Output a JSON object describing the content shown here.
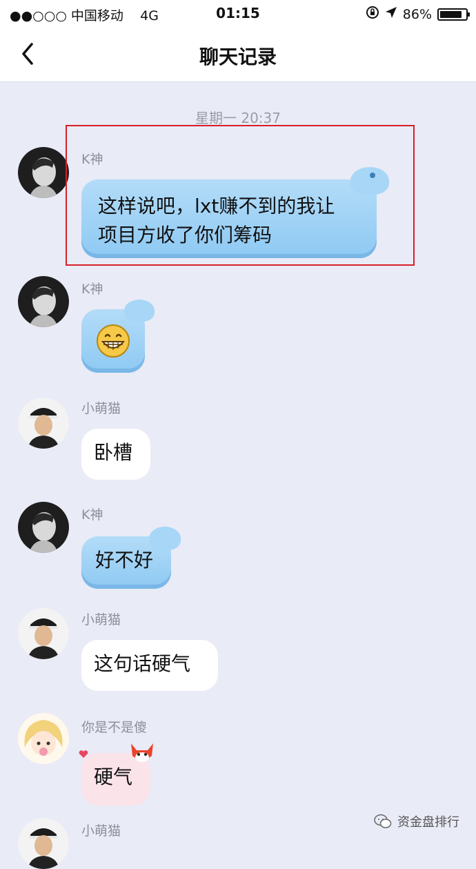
{
  "status_bar": {
    "carrier": "●●○○○ 中国移动",
    "network": "4G",
    "time": "01:15",
    "battery": "86%",
    "battery_level": 0.86
  },
  "nav": {
    "title": "聊天记录"
  },
  "chat": {
    "timestamp": "星期一 20:37",
    "messages": [
      {
        "sender": "K神",
        "text": "这样说吧，lxt赚不到的我让项目方收了你们筹码",
        "line1": "这样说吧，lxt赚不到的我让",
        "line2": "项目方收了你们筹码"
      },
      {
        "sender": "K神",
        "emoji": "grinning-face"
      },
      {
        "sender": "小萌猫",
        "text": "卧槽"
      },
      {
        "sender": "K神",
        "text": "好不好"
      },
      {
        "sender": "小萌猫",
        "text": "这句话硬气"
      },
      {
        "sender": "你是不是傻",
        "text": "硬气"
      },
      {
        "sender": "小萌猫"
      }
    ]
  },
  "watermark": {
    "text": "资金盘排行"
  },
  "colors": {
    "chat_background": "#e9ebf6",
    "bubble_blue": "#9fd2f6",
    "highlight": "#d81e28"
  }
}
